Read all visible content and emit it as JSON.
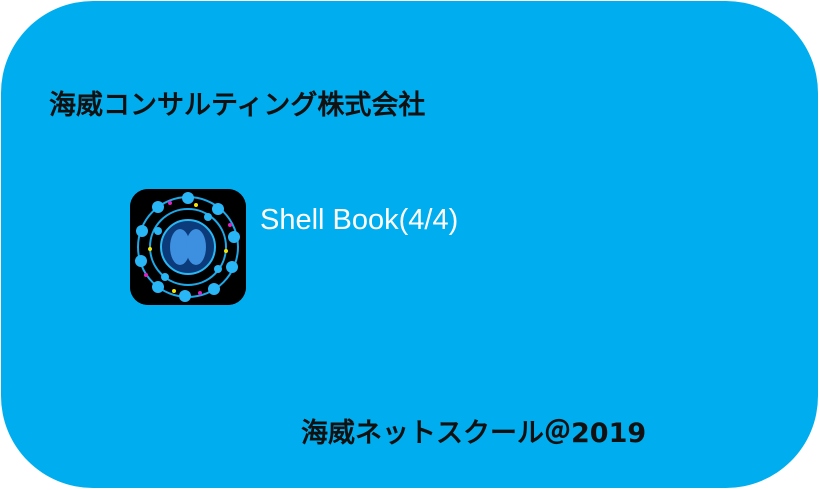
{
  "header": {
    "company": "海威コンサルティング株式会社"
  },
  "app": {
    "title": "Shell Book(4/4)",
    "icon": "brain-network-icon"
  },
  "footer": {
    "text": "海威ネットスクール＠2019"
  },
  "colors": {
    "background": "#00AEEF",
    "text": "#111111",
    "title": "#FFFFFF"
  }
}
